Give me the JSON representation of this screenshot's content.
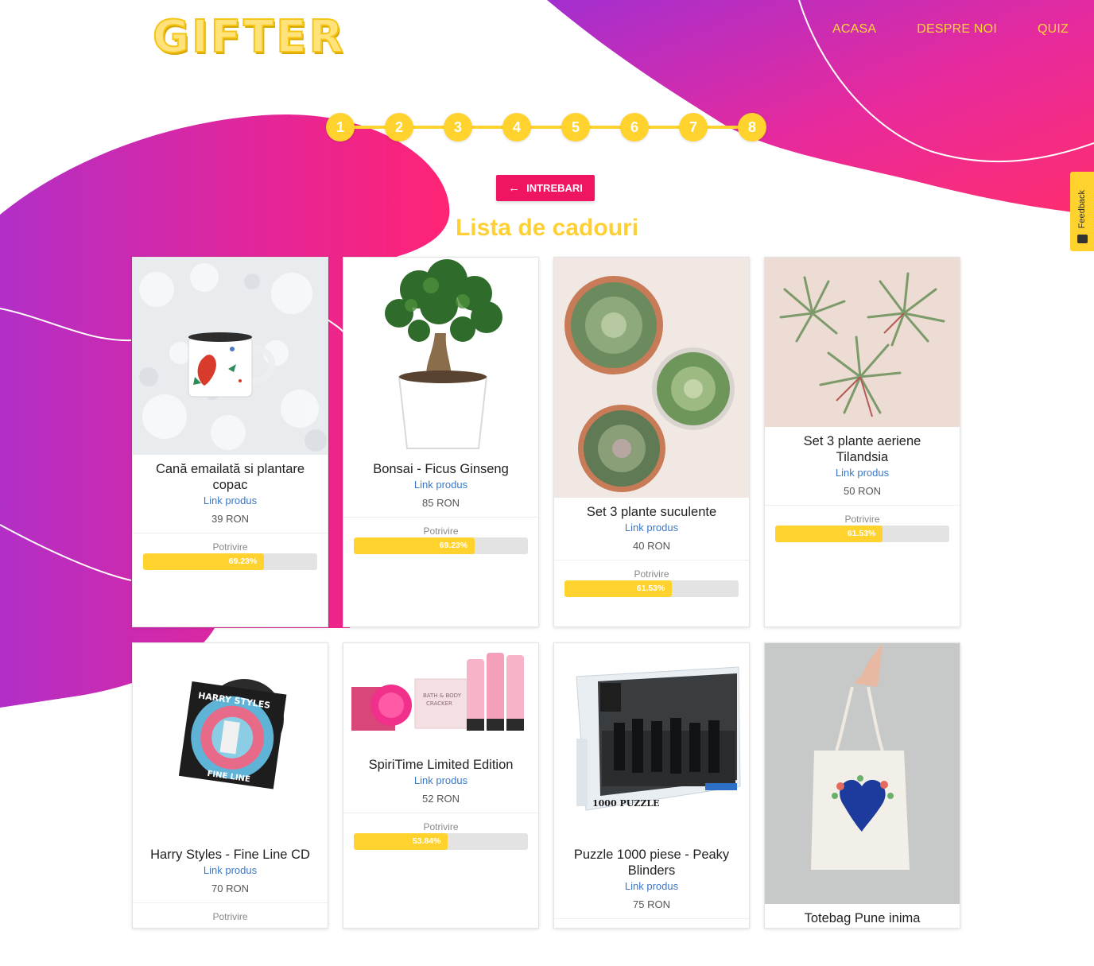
{
  "header": {
    "logo": "GIFTER",
    "nav": [
      {
        "label": "ACASA"
      },
      {
        "label": "DESPRE NOI"
      },
      {
        "label": "QUIZ"
      }
    ]
  },
  "steps": [
    "1",
    "2",
    "3",
    "4",
    "5",
    "6",
    "7",
    "8"
  ],
  "back_button": {
    "label": "INTREBARI",
    "icon": "arrow-left-icon"
  },
  "page_title": "Lista de cadouri",
  "feedback_tab": {
    "label": "Feedback",
    "icon": "chat-icon"
  },
  "colors": {
    "accent_yellow": "#ffd22e",
    "accent_pink": "#ef1563",
    "blob_purple": "#b62fc6",
    "link_blue": "#3b78c9"
  },
  "products": [
    {
      "name": "Cană emailată si plantare copac",
      "link": "Link produs",
      "price": "39 RON",
      "match_label": "Potrivire",
      "match": "69.23%",
      "match_value": 0.6923,
      "image": "enamel-mug-in-snow"
    },
    {
      "name": "Bonsai - Ficus Ginseng",
      "link": "Link produs",
      "price": "85 RON",
      "match_label": "Potrivire",
      "match": "69.23%",
      "match_value": 0.6923,
      "image": "bonsai-in-white-pot"
    },
    {
      "name": "Set 3 plante suculente",
      "link": "Link produs",
      "price": "40 RON",
      "match_label": "Potrivire",
      "match": "61.53%",
      "match_value": 0.6153,
      "image": "three-succulents"
    },
    {
      "name": "Set 3 plante aeriene Tilandsia",
      "link": "Link produs",
      "price": "50 RON",
      "match_label": "Potrivire",
      "match": "61.53%",
      "match_value": 0.6153,
      "image": "three-air-plants"
    },
    {
      "name": "Harry Styles - Fine Line CD",
      "link": "Link produs",
      "price": "70 RON",
      "match_label": "Potrivire",
      "image": "cd-album"
    },
    {
      "name": "SpiriTime Limited Edition",
      "link": "Link produs",
      "price": "52 RON",
      "match_label": "Potrivire",
      "match": "53.84%",
      "match_value": 0.5384,
      "image": "bath-body-gift-set"
    },
    {
      "name": "Puzzle 1000 piese - Peaky Blinders",
      "link": "Link produs",
      "price": "75 RON",
      "image": "puzzle-box"
    },
    {
      "name": "Totebag Pune inima",
      "image": "tote-bag"
    }
  ]
}
